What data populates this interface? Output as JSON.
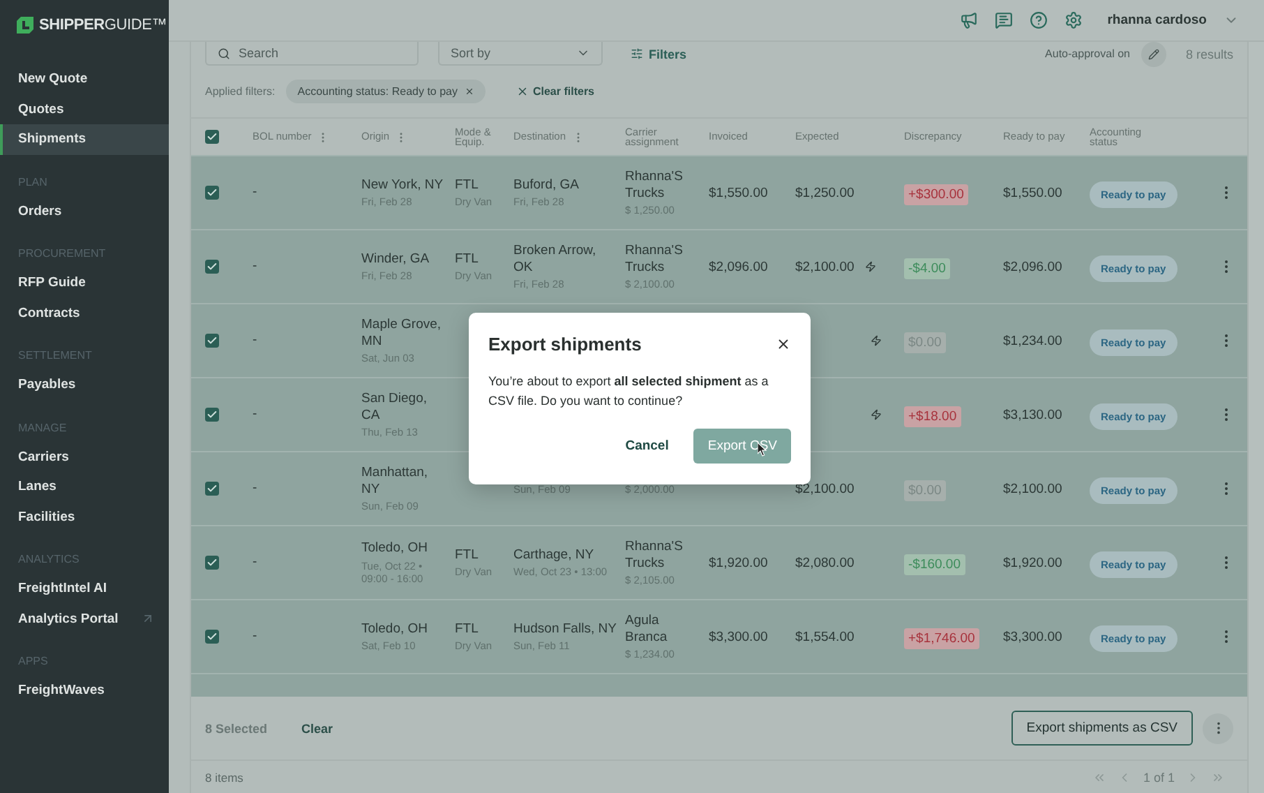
{
  "sidebar": {
    "logo": "**SHIPPER**GUIDE™",
    "sections": [
      {
        "items": [
          {
            "label": "New Quote",
            "selected": false
          },
          {
            "label": "Quotes",
            "selected": false
          },
          {
            "label": "Shipments",
            "selected": true
          }
        ]
      },
      {
        "title": "PLAN",
        "items": [
          {
            "label": "Orders",
            "selected": false
          }
        ]
      },
      {
        "title": "PROCUREMENT",
        "items": [
          {
            "label": "RFP Guide",
            "selected": false
          },
          {
            "label": "Contracts",
            "selected": false
          }
        ]
      },
      {
        "title": "SETTLEMENT",
        "items": [
          {
            "label": "Payables",
            "selected": false
          }
        ]
      },
      {
        "title": "MANAGE",
        "items": [
          {
            "label": "Carriers",
            "selected": false
          },
          {
            "label": "Lanes",
            "selected": false
          },
          {
            "label": "Facilities",
            "selected": false
          }
        ]
      },
      {
        "title": "ANALYTICS",
        "items": [
          {
            "label": "FreightIntel AI",
            "selected": false
          },
          {
            "label": "Analytics Portal",
            "selected": false,
            "external": true
          }
        ]
      },
      {
        "title": "APPS",
        "items": [
          {
            "label": "FreightWaves",
            "selected": false
          }
        ]
      }
    ]
  },
  "header": {
    "user": "rhanna cardoso"
  },
  "toolbar": {
    "search": {
      "placeholder": "Search"
    },
    "sort": {
      "placeholder": "Sort by"
    },
    "filters": "Filters",
    "auto_approval": "Auto-approval on",
    "results": "8 results"
  },
  "applied_filters": {
    "label": "Applied filters:",
    "chips": [
      "Accounting status: Ready to pay"
    ],
    "clear": "Clear filters"
  },
  "table": {
    "all_selected": true,
    "columns": [
      {
        "label": "BOL number",
        "menu": true
      },
      {
        "label": "Origin",
        "menu": true
      },
      {
        "label": "Mode & Equip.",
        "menu": false
      },
      {
        "label": "Destination",
        "menu": true
      },
      {
        "label": "Carrier assignment",
        "menu": false
      },
      {
        "label": "Invoiced",
        "menu": false
      },
      {
        "label": "Expected",
        "menu": false
      },
      {
        "label": "Discrepancy",
        "menu": false
      },
      {
        "label": "Ready to pay",
        "menu": false
      },
      {
        "label": "Accounting status",
        "menu": false
      }
    ],
    "rows": [
      {
        "selected": true,
        "bol": "-",
        "origin": {
          "city": "New York, NY",
          "date": "Fri, Feb 28"
        },
        "mode": {
          "name": "FTL",
          "equipment": "Dry Van"
        },
        "destination": {
          "city": "Buford, GA",
          "date": "Fri, Feb 28"
        },
        "carrier": {
          "name": "Rhanna'S Trucks",
          "amount": "$ 1,250.00"
        },
        "invoiced": "$1,550.00",
        "expected": "$1,250.00",
        "flash": false,
        "discrepancy": {
          "text": "+$300.00",
          "kind": "over"
        },
        "ready_to_pay": "$1,550.00",
        "status": "Ready to pay"
      },
      {
        "selected": true,
        "bol": "-",
        "origin": {
          "city": "Winder, GA",
          "date": "Fri, Feb 28"
        },
        "mode": {
          "name": "FTL",
          "equipment": "Dry Van"
        },
        "destination": {
          "city": "Broken Arrow, OK",
          "date": "Fri, Feb 28"
        },
        "carrier": {
          "name": "Rhanna'S Trucks",
          "amount": "$ 2,100.00"
        },
        "invoiced": "$2,096.00",
        "expected": "$2,100.00",
        "flash": true,
        "discrepancy": {
          "text": "-$4.00",
          "kind": "under"
        },
        "ready_to_pay": "$2,096.00",
        "status": "Ready to pay"
      },
      {
        "selected": true,
        "bol": "-",
        "origin": {
          "city": "Maple Grove, MN",
          "date": "Sat, Jun 03"
        },
        "flash": true,
        "discrepancy": {
          "text": "$0.00",
          "kind": "zero"
        },
        "ready_to_pay": "$1,234.00",
        "status": "Ready to pay"
      },
      {
        "selected": true,
        "bol": "-",
        "origin": {
          "city": "San Diego, CA",
          "date": "Thu, Feb 13"
        },
        "flash": true,
        "discrepancy": {
          "text": "+$18.00",
          "kind": "over"
        },
        "ready_to_pay": "$3,130.00",
        "status": "Ready to pay"
      },
      {
        "selected": true,
        "bol": "-",
        "origin": {
          "city": "Manhattan, NY",
          "date": "Sun, Feb 09"
        },
        "destination": {
          "date": "Sun, Feb 09"
        },
        "carrier": {
          "amount": "$ 2,000.00"
        },
        "expected": "$2,100.00",
        "flash": false,
        "discrepancy": {
          "text": "$0.00",
          "kind": "zero"
        },
        "ready_to_pay": "$2,100.00",
        "status": "Ready to pay"
      },
      {
        "selected": true,
        "bol": "-",
        "origin": {
          "city": "Toledo, OH",
          "date": "Tue, Oct 22 • 09:00 - 16:00"
        },
        "mode": {
          "name": "FTL",
          "equipment": "Dry Van"
        },
        "destination": {
          "city": "Carthage, NY",
          "date": "Wed, Oct 23 • 13:00"
        },
        "carrier": {
          "name": "Rhanna'S Trucks",
          "amount": "$ 2,105.00"
        },
        "invoiced": "$1,920.00",
        "expected": "$2,080.00",
        "flash": false,
        "discrepancy": {
          "text": "-$160.00",
          "kind": "under"
        },
        "ready_to_pay": "$1,920.00",
        "status": "Ready to pay"
      },
      {
        "selected": true,
        "bol": "-",
        "origin": {
          "city": "Toledo, OH",
          "date": "Sat, Feb 10"
        },
        "mode": {
          "name": "FTL",
          "equipment": "Dry Van"
        },
        "destination": {
          "city": "Hudson Falls, NY",
          "date": "Sun, Feb 11"
        },
        "carrier": {
          "name": "Agula Branca",
          "amount": "$ 1,234.00"
        },
        "invoiced": "$3,300.00",
        "expected": "$1,554.00",
        "flash": false,
        "discrepancy": {
          "text": "+$1,746.00",
          "kind": "over"
        },
        "ready_to_pay": "$3,300.00",
        "status": "Ready to pay"
      }
    ]
  },
  "selection_bar": {
    "count": "8 Selected",
    "clear": "Clear",
    "export": "Export shipments as CSV"
  },
  "pagination": {
    "items": "8 items",
    "page": "1 of 1"
  },
  "modal": {
    "title": "Export shipments",
    "body": "You’re about to export **all selected shipment** as a CSV file. Do you want to continue?",
    "cancel": "Cancel",
    "confirm": {
      "label": "Export CSV",
      "disabled": true
    }
  }
}
